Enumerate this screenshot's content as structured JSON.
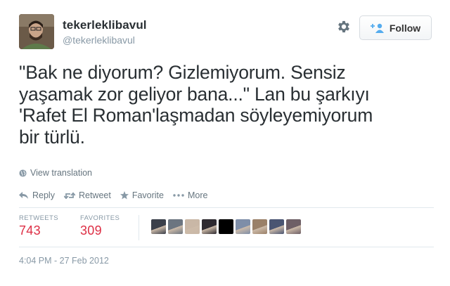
{
  "user": {
    "fullname": "tekerleklibavul",
    "username": "@tekerleklibavul",
    "avatar_icon": "profile-photo"
  },
  "header": {
    "gear_icon": "gear-icon",
    "follow_label": "Follow",
    "follow_icon": "add-user-icon"
  },
  "tweet": {
    "lines": [
      "\"Bak ne diyorum? Gizlemiyorum. Sensiz",
      "yaşamak zor geliyor bana...\" Lan bu şarkıyı",
      "'Rafet El Roman'laşmadan söyleyemiyorum",
      "bir türlü."
    ],
    "translate_label": "View translation"
  },
  "actions": {
    "reply": "Reply",
    "retweet": "Retweet",
    "favorite": "Favorite",
    "more": "More"
  },
  "stats": {
    "retweets_label": "RETWEETS",
    "retweets_value": "743",
    "favorites_label": "FAVORITES",
    "favorites_value": "309"
  },
  "favoriters": [
    {
      "color": "#3a3f4a"
    },
    {
      "color": "#6c7580"
    },
    {
      "color": "#c9b7a6"
    },
    {
      "color": "#2e2a30"
    },
    {
      "color": "#000000"
    },
    {
      "color": "#7e8ea8"
    },
    {
      "color": "#9a8068"
    },
    {
      "color": "#4a5572"
    },
    {
      "color": "#6e5f66"
    }
  ],
  "timestamp": "4:04 PM - 27 Feb 2012",
  "colors": {
    "accent_red": "#dd2e44",
    "text": "#292f33",
    "muted": "#8899a6",
    "follow_blue": "#55acee"
  }
}
